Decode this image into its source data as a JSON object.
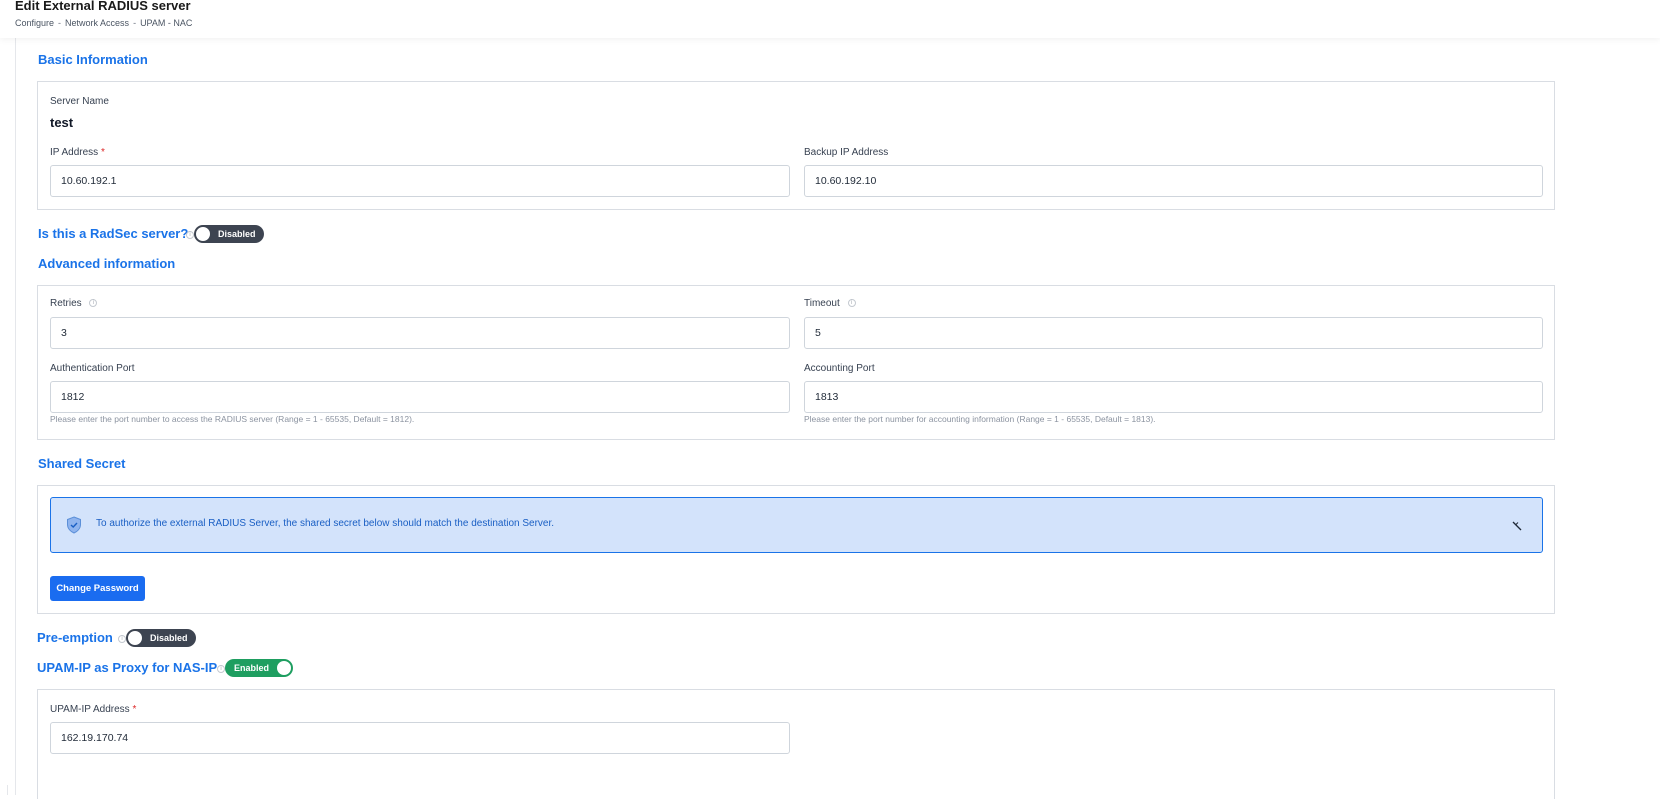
{
  "header": {
    "title": "Edit External RADIUS server",
    "breadcrumb": [
      "Configure",
      "Network Access",
      "UPAM - NAC"
    ],
    "separator": "-"
  },
  "basic": {
    "section_title": "Basic Information",
    "server_name_label": "Server Name",
    "server_name_value": "test",
    "ip_label": "IP Address",
    "ip_value": "10.60.192.1",
    "backup_ip_label": "Backup IP Address",
    "backup_ip_value": "10.60.192.10",
    "required_mark": "*"
  },
  "radsec": {
    "label": "Is this a RadSec server?",
    "toggle_text": "Disabled",
    "enabled": false
  },
  "advanced": {
    "section_title": "Advanced information",
    "retries_label": "Retries",
    "retries_value": "3",
    "timeout_label": "Timeout",
    "timeout_value": "5",
    "auth_port_label": "Authentication Port",
    "auth_port_value": "1812",
    "auth_port_help": "Please enter the port number to access the RADIUS server (Range = 1 - 65535, Default = 1812).",
    "acct_port_label": "Accounting Port",
    "acct_port_value": "1813",
    "acct_port_help": "Please enter the port number for accounting information (Range = 1 - 65535, Default = 1813)."
  },
  "shared_secret": {
    "section_title": "Shared Secret",
    "alert_text": "To authorize the external RADIUS Server, the shared secret below should match the destination Server.",
    "change_password_label": "Change Password"
  },
  "preemption": {
    "label": "Pre-emption",
    "toggle_text": "Disabled",
    "enabled": false
  },
  "proxy": {
    "label": "UPAM-IP as Proxy for NAS-IP",
    "toggle_text": "Enabled",
    "enabled": true,
    "upam_ip_label": "UPAM-IP Address",
    "upam_ip_value": "162.19.170.74",
    "required_mark": "*"
  },
  "colors": {
    "accent": "#1a73e8",
    "toggle_off": "#3d4451",
    "toggle_on": "#1e9e60",
    "alert_bg": "#d3e3fb",
    "required": "#dc2626"
  },
  "icons": [
    "info-icon",
    "shield-check-icon",
    "close-icon"
  ]
}
